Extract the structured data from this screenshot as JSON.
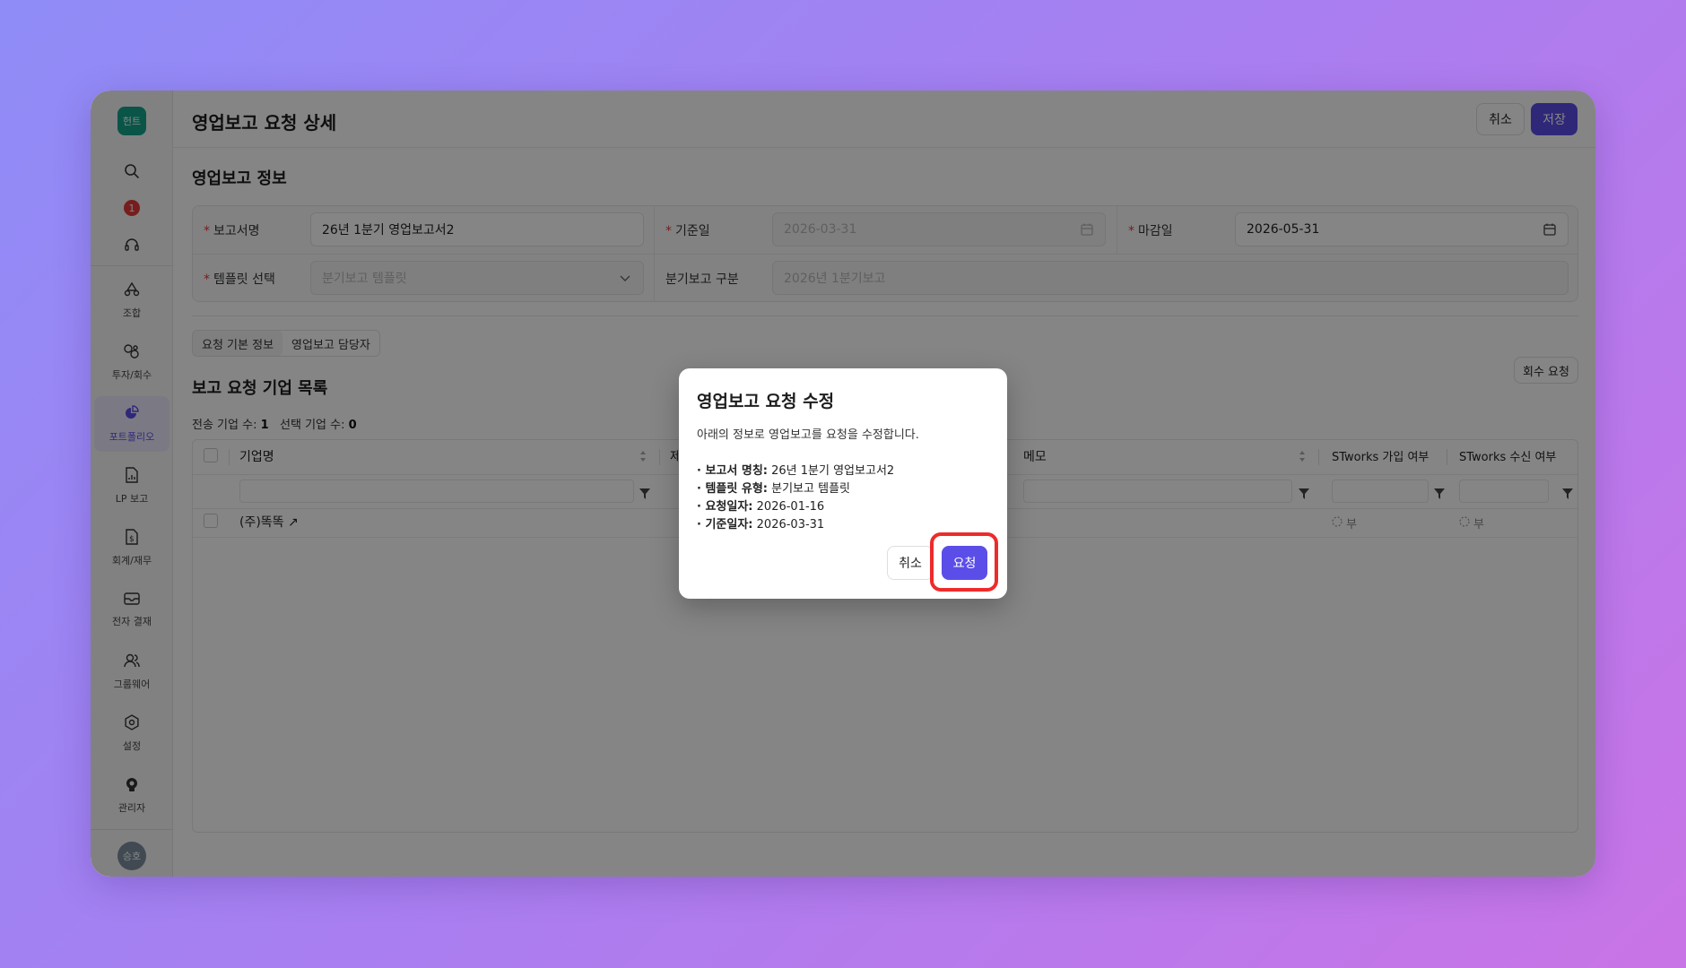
{
  "app": {
    "logo_text": "헌트",
    "notification_count": "1",
    "user_avatar_text": "승호"
  },
  "sidebar": {
    "items": [
      {
        "label": "조합",
        "icon": "cooperative-icon"
      },
      {
        "label": "투자/회수",
        "icon": "investment-icon"
      },
      {
        "label": "포트폴리오",
        "icon": "portfolio-icon",
        "active": true
      },
      {
        "label": "LP 보고",
        "icon": "report-document-icon"
      },
      {
        "label": "회계/재무",
        "icon": "accounting-icon"
      },
      {
        "label": "전자 결재",
        "icon": "mail-icon"
      },
      {
        "label": "그룹웨어",
        "icon": "people-icon"
      },
      {
        "label": "설정",
        "icon": "gear-icon"
      },
      {
        "label": "관리자",
        "icon": "admin-icon"
      }
    ]
  },
  "header": {
    "title": "영업보고 요청 상세",
    "cancel_label": "취소",
    "save_label": "저장"
  },
  "info_section": {
    "title": "영업보고 정보",
    "fields": {
      "report_name": {
        "label": "보고서명",
        "value": "26년 1분기 영업보고서2"
      },
      "base_date": {
        "label": "기준일",
        "value": "2026-03-31"
      },
      "due_date": {
        "label": "마감일",
        "value": "2026-05-31"
      },
      "template": {
        "label": "템플릿 선택",
        "value": "분기보고 템플릿"
      },
      "quarter_type": {
        "label": "분기보고 구분",
        "value": "2026년 1분기보고"
      }
    }
  },
  "tabs": [
    {
      "label": "요청 기본 정보",
      "active": true
    },
    {
      "label": "영업보고 담당자",
      "active": false
    }
  ],
  "company_list": {
    "title": "보고 요청 기업 목록",
    "recall_button": "회수 요청",
    "sent_count_label": "전송 기업 수:",
    "sent_count": "1",
    "selected_count_label": "선택 기업 수:",
    "selected_count": "0",
    "columns": [
      "기업명",
      "제",
      "메모",
      "STworks 가입 여부",
      "STworks 수신 여부"
    ],
    "rows": [
      {
        "company": "(주)똑똑",
        "stworks_joined": "부",
        "stworks_received": "부"
      }
    ]
  },
  "modal": {
    "title": "영업보고 요청 수정",
    "description": "아래의 정보로 영업보고를 요청을 수정합니다.",
    "details": [
      {
        "key": "· 보고서 명칭:",
        "value": "26년 1분기 영업보고서2"
      },
      {
        "key": "· 템플릿 유형:",
        "value": "분기보고 템플릿"
      },
      {
        "key": "· 요청일자:",
        "value": "2026-01-16"
      },
      {
        "key": "· 기준일자:",
        "value": "2026-03-31"
      }
    ],
    "cancel_label": "취소",
    "confirm_label": "요청"
  },
  "colors": {
    "accent": "#5b4ee8",
    "highlight": "#ee2b2b",
    "logo_bg": "#14a38b"
  }
}
